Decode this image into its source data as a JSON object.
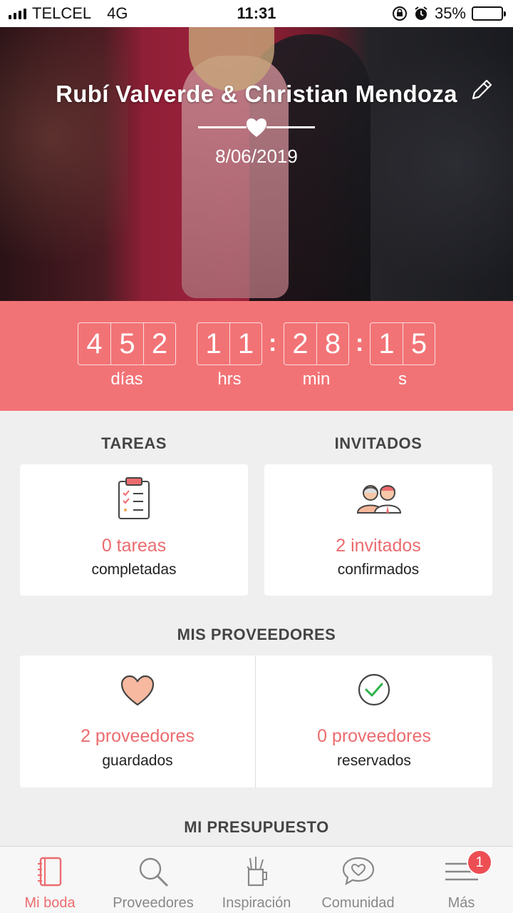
{
  "status_bar": {
    "carrier": "TELCEL",
    "network": "4G",
    "time": "11:31",
    "battery": "35%",
    "battery_level": 0.35
  },
  "hero": {
    "couple": "Rubí Valverde & Christian Mendoza",
    "date": "8/06/2019"
  },
  "countdown": {
    "days": [
      "4",
      "5",
      "2"
    ],
    "hours": [
      "1",
      "1"
    ],
    "minutes": [
      "2",
      "8"
    ],
    "seconds": [
      "1",
      "5"
    ],
    "separator": ":",
    "labels": {
      "days": "días",
      "hours": "hrs",
      "minutes": "min",
      "seconds": "s"
    }
  },
  "tasks": {
    "title": "TAREAS",
    "count": "0 tareas",
    "sub": "completadas"
  },
  "guests": {
    "title": "INVITADOS",
    "count": "2 invitados",
    "sub": "confirmados"
  },
  "vendors": {
    "title": "MIS PROVEEDORES",
    "saved": {
      "count": "2 proveedores",
      "sub": "guardados"
    },
    "booked": {
      "count": "0 proveedores",
      "sub": "reservados"
    }
  },
  "budget": {
    "title": "MI PRESUPUESTO"
  },
  "tabs": [
    {
      "label": "Mi boda",
      "icon": "notebook-icon"
    },
    {
      "label": "Proveedores",
      "icon": "search-icon"
    },
    {
      "label": "Inspiración",
      "icon": "pencil-cup-icon"
    },
    {
      "label": "Comunidad",
      "icon": "heart-chat-icon"
    },
    {
      "label": "Más",
      "icon": "menu-icon",
      "badge": "1"
    }
  ],
  "colors": {
    "accent": "#f27376",
    "accent_text": "#ec6b6e",
    "background": "#efefef"
  }
}
